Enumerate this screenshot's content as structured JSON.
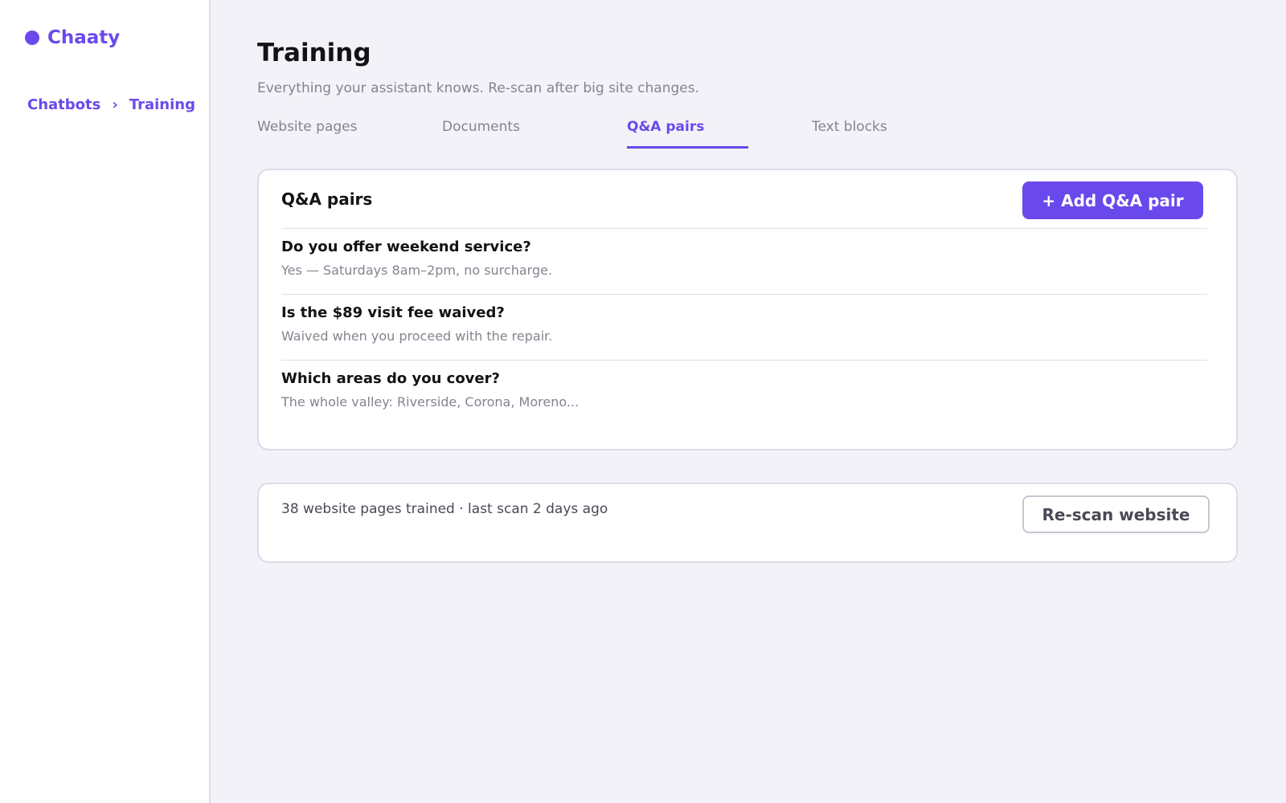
{
  "brand": {
    "name": "Chaaty"
  },
  "breadcrumb": {
    "items": [
      "Chatbots",
      "Training"
    ],
    "separator": "›"
  },
  "page": {
    "title": "Training",
    "subtitle": "Everything your assistant knows. Re-scan after big site changes."
  },
  "tabs": [
    {
      "label": "Website pages",
      "active": false
    },
    {
      "label": "Documents",
      "active": false
    },
    {
      "label": "Q&A pairs",
      "active": true
    },
    {
      "label": "Text blocks",
      "active": false
    }
  ],
  "qa_card": {
    "title": "Q&A pairs",
    "add_button": "+ Add Q&A pair",
    "items": [
      {
        "question": "Do you offer weekend service?",
        "answer": "Yes — Saturdays 8am–2pm, no surcharge."
      },
      {
        "question": "Is the $89 visit fee waived?",
        "answer": "Waived when you proceed with the repair."
      },
      {
        "question": "Which areas do you cover?",
        "answer": "The whole valley: Riverside, Corona, Moreno..."
      }
    ]
  },
  "scan_card": {
    "status": "38 website pages trained · last scan 2 days ago",
    "rescan_button": "Re-scan website"
  },
  "colors": {
    "accent": "#6a49ec",
    "background": "#f3f2f8",
    "card": "#ffffff",
    "muted_text": "#85838f"
  },
  "icons": {
    "brand": "dot-icon"
  }
}
